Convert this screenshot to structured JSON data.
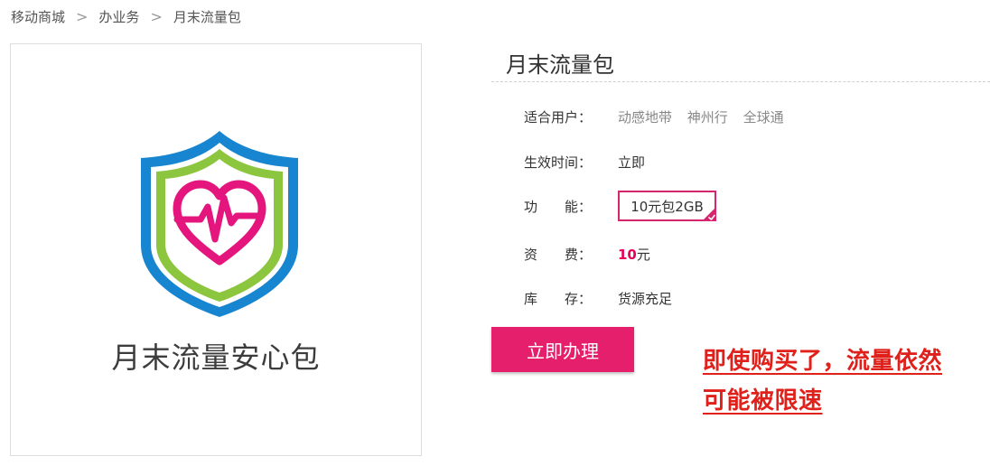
{
  "breadcrumb": {
    "items": [
      {
        "label": "移动商城"
      },
      {
        "label": "办业务"
      },
      {
        "label": "月末流量包"
      }
    ],
    "separator": ">"
  },
  "product": {
    "image_caption": "月末流量安心包",
    "title": "月末流量包",
    "attributes": {
      "users_label": "适合用户：",
      "users": [
        "动感地带",
        "神州行",
        "全球通"
      ],
      "effective_label": "生效时间：",
      "effective_value": "立即",
      "function_label": "功　　能：",
      "function_option": "10元包2GB",
      "fee_label": "资　　费：",
      "fee_number": "10",
      "fee_unit": "元",
      "stock_label": "库　　存：",
      "stock_value": "货源充足"
    },
    "buy_button": "立即办理"
  },
  "annotation": {
    "line1": "即使购买了，流量依然",
    "line2": "可能被限速"
  },
  "colors": {
    "accent": "#e51f6b",
    "shield_blue": "#1785cf",
    "shield_green": "#8cc63f",
    "heart_pink": "#e5157e",
    "annotation_red": "#e0201b"
  },
  "icons": {
    "shield": "shield-heart-icon",
    "selected": "check-corner-icon",
    "separator": "chevron-right-icon"
  }
}
